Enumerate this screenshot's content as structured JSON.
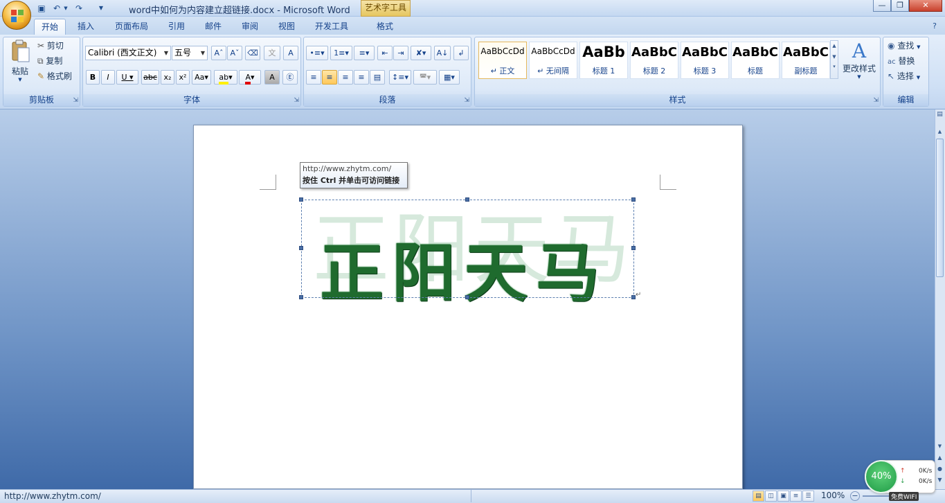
{
  "title_bar": {
    "document_title": "word中如何为内容建立超链接.docx - Microsoft Word",
    "context_tab": "艺术字工具"
  },
  "tabs": [
    "开始",
    "插入",
    "页面布局",
    "引用",
    "邮件",
    "审阅",
    "视图",
    "开发工具",
    "格式"
  ],
  "clipboard": {
    "paste": "粘贴",
    "cut": "剪切",
    "copy": "复制",
    "format_painter": "格式刷",
    "group": "剪贴板"
  },
  "font": {
    "name": "Calibri (西文正文)",
    "size": "五号",
    "group": "字体"
  },
  "paragraph": {
    "group": "段落"
  },
  "styles": {
    "group": "样式",
    "tiles": [
      {
        "sample": "AaBbCcDd",
        "name": "↵ 正文"
      },
      {
        "sample": "AaBbCcDd",
        "name": "↵ 无间隔"
      },
      {
        "sample": "AaBb",
        "name": "标题 1"
      },
      {
        "sample": "AaBbC",
        "name": "标题 2"
      },
      {
        "sample": "AaBbC",
        "name": "标题 3"
      },
      {
        "sample": "AaBbC",
        "name": "标题"
      },
      {
        "sample": "AaBbC",
        "name": "副标题"
      }
    ],
    "change_styles": "更改样式"
  },
  "editing": {
    "find": "查找",
    "replace": "替换",
    "select": "选择",
    "group": "编辑"
  },
  "document": {
    "wordart_text": "正阳天马",
    "tooltip_url": "http://www.zhytm.com/",
    "tooltip_hint": "按住 Ctrl 并单击可访问链接",
    "paragraph_mark": "↵"
  },
  "status_bar": {
    "url": "http://www.zhytm.com/",
    "zoom": "100%"
  },
  "net_widget": {
    "percent": "40%",
    "up": "0K/s",
    "down": "0K/s",
    "wifi": "免费WIFI"
  }
}
